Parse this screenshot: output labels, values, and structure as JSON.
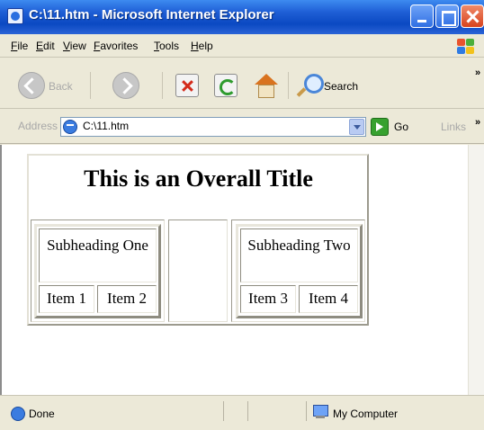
{
  "window": {
    "title": "C:\\11.htm - Microsoft Internet Explorer"
  },
  "menu": {
    "items": [
      "File",
      "Edit",
      "View",
      "Favorites",
      "Tools",
      "Help"
    ]
  },
  "toolbar": {
    "back_label": "Back",
    "search_label": "Search",
    "chevron": "»"
  },
  "address_bar": {
    "label": "Address",
    "value": "C:\\11.htm",
    "go_label": "Go",
    "links_label": "Links",
    "chevron": "»"
  },
  "page": {
    "overall_title": "This is an Overall Title",
    "tables": [
      {
        "subheading": "Subheading One",
        "items": [
          "Item 1",
          "Item 2"
        ]
      },
      {
        "subheading": "Subheading Two",
        "items": [
          "Item 3",
          "Item 4"
        ]
      }
    ]
  },
  "status_bar": {
    "status": "Done",
    "zone": "My Computer"
  },
  "colors": {
    "title_bar": "#0b49c2",
    "chrome": "#ece9d8",
    "close_button": "#d8431d"
  }
}
